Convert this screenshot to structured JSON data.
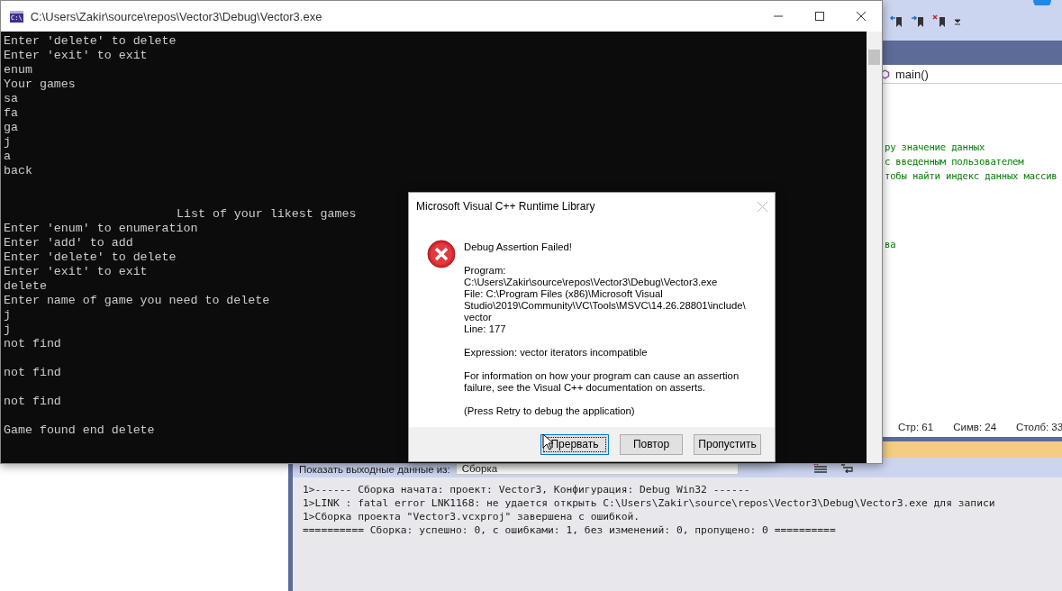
{
  "ide": {
    "navigation": {
      "function": "main()"
    },
    "code_blocks": [
      [
        "ру значение данных",
        "с введенным пользователем",
        "тобы найти индекс данных массив"
      ],
      [
        "ва"
      ]
    ],
    "status_bar": [
      "Стр: 61",
      "Симв: 24",
      "Столб: 33"
    ],
    "output": {
      "label": "Показать выходные данные из:",
      "source": "Сборка",
      "lines": [
        "1>------ Сборка начата: проект: Vector3, Конфигурация: Debug Win32 ------",
        "1>LINK : fatal error LNK1168: не удается открыть C:\\Users\\Zakir\\source\\repos\\Vector3\\Debug\\Vector3.exe для записи",
        "1>Сборка проекта \"Vector3.vcxproj\" завершена с ошибкой.",
        "========== Сборка: успешно: 0, с ошибками: 1, без изменений: 0, пропущено: 0 =========="
      ]
    }
  },
  "console": {
    "title": "C:\\Users\\Zakir\\source\\repos\\Vector3\\Debug\\Vector3.exe",
    "app_icon": "C:\\",
    "lines": [
      {
        "text": "Enter 'delete' to delete",
        "kind": "plain"
      },
      {
        "text": "Enter 'exit' to exit",
        "kind": "plain"
      },
      {
        "text": "enum",
        "kind": "plain"
      },
      {
        "text": "Your games",
        "kind": "plain"
      },
      {
        "text": "sa",
        "kind": "plain"
      },
      {
        "text": "fa",
        "kind": "plain"
      },
      {
        "text": "ga",
        "kind": "plain"
      },
      {
        "text": "j",
        "kind": "plain"
      },
      {
        "text": "a",
        "kind": "plain"
      },
      {
        "text": "back",
        "kind": "plain"
      },
      {
        "text": "List of your likest games",
        "kind": "heading"
      },
      {
        "text": "Enter 'enum' to enumeration",
        "kind": "plain"
      },
      {
        "text": "Enter 'add' to add",
        "kind": "plain"
      },
      {
        "text": "Enter 'delete' to delete",
        "kind": "plain"
      },
      {
        "text": "Enter 'exit' to exit",
        "kind": "plain"
      },
      {
        "text": "delete",
        "kind": "plain"
      },
      {
        "text": "Enter name of game you need to delete",
        "kind": "plain"
      },
      {
        "text": "j",
        "kind": "plain"
      },
      {
        "text": "j",
        "kind": "plain"
      },
      {
        "text": "not find",
        "kind": "spaced"
      },
      {
        "text": "not find",
        "kind": "spaced"
      },
      {
        "text": "not find",
        "kind": "spaced"
      },
      {
        "text": "Game found end delete",
        "kind": "plain"
      }
    ]
  },
  "dialog": {
    "title": "Microsoft Visual C++ Runtime Library",
    "paragraphs": [
      [
        "Debug Assertion Failed!"
      ],
      [
        "Program:",
        "C:\\Users\\Zakir\\source\\repos\\Vector3\\Debug\\Vector3.exe",
        "File: C:\\Program Files (x86)\\Microsoft Visual",
        "Studio\\2019\\Community\\VC\\Tools\\MSVC\\14.26.28801\\include\\",
        "vector",
        "Line: 177"
      ],
      [
        "Expression: vector iterators incompatible"
      ],
      [
        "For information on how your program can cause an assertion",
        "failure, see the Visual C++ documentation on asserts."
      ],
      [
        "(Press Retry to debug the application)"
      ]
    ],
    "buttons": [
      {
        "label": "Прервать",
        "selected": true
      },
      {
        "label": "Повтор",
        "selected": false
      },
      {
        "label": "Пропустить",
        "selected": false
      }
    ]
  }
}
